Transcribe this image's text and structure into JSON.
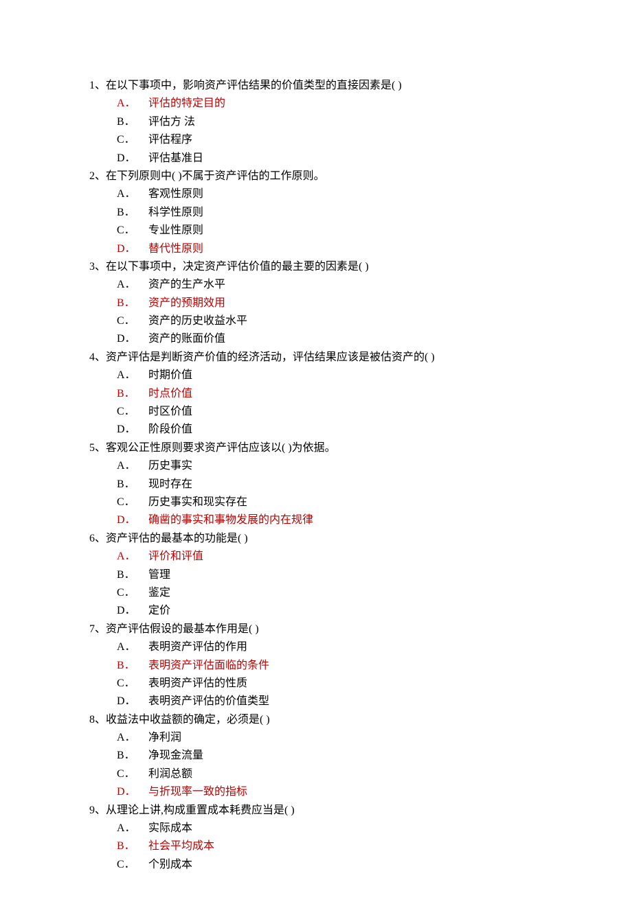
{
  "questions": [
    {
      "num": "1、",
      "text": "在以下事项中，影响资产评估结果的价值类型的直接因素是(    )",
      "options": [
        {
          "letter": "A．",
          "text": "评估的特定目的",
          "correct": true
        },
        {
          "letter": "B．",
          "text": "评估方 法",
          "correct": false
        },
        {
          "letter": "C．",
          "text": "评估程序",
          "correct": false
        },
        {
          "letter": "D．",
          "text": "评估基准日",
          "correct": false
        }
      ]
    },
    {
      "num": "2、",
      "text": "在下列原则中(      )不属于资产评估的工作原则。",
      "options": [
        {
          "letter": "A．",
          "text": "客观性原则",
          "correct": false
        },
        {
          "letter": "B．",
          "text": "科学性原则",
          "correct": false
        },
        {
          "letter": "C．",
          "text": "专业性原则",
          "correct": false
        },
        {
          "letter": "D．",
          "text": "替代性原则",
          "correct": true
        }
      ]
    },
    {
      "num": "3、",
      "text": "在以下事项中，决定资产评估价值的最主要的因素是(    )",
      "options": [
        {
          "letter": "A．",
          "text": "资产的生产水平",
          "correct": false
        },
        {
          "letter": "B．",
          "text": "资产的预期效用",
          "correct": true
        },
        {
          "letter": "C．",
          "text": "资产的历史收益水平",
          "correct": false
        },
        {
          "letter": "D．",
          "text": "资产的账面价值",
          "correct": false
        }
      ]
    },
    {
      "num": "4、",
      "text": "资产评估是判断资产价值的经济活动，评估结果应该是被估资产的(        )",
      "options": [
        {
          "letter": "A．",
          "text": "时期价值",
          "correct": false
        },
        {
          "letter": "B．",
          "text": "时点价值",
          "correct": true
        },
        {
          "letter": "C．",
          "text": "时区价值",
          "correct": false
        },
        {
          "letter": "D．",
          "text": "阶段价值",
          "correct": false
        }
      ]
    },
    {
      "num": "5、",
      "text": "客观公正性原则要求资产评估应该以(          )为依据。",
      "options": [
        {
          "letter": "A．",
          "text": "历史事实",
          "correct": false
        },
        {
          "letter": "B．",
          "text": "现时存在",
          "correct": false
        },
        {
          "letter": "C．",
          "text": "历史事实和现实存在",
          "correct": false
        },
        {
          "letter": "D．",
          "text": "确凿的事实和事物发展的内在规律",
          "correct": true
        }
      ]
    },
    {
      "num": "6、",
      "text": "资产评估的最基本的功能是(        )",
      "options": [
        {
          "letter": "A．",
          "text": "评价和评值",
          "correct": true
        },
        {
          "letter": "B．",
          "text": "管理",
          "correct": false
        },
        {
          "letter": "C．",
          "text": "鉴定",
          "correct": false
        },
        {
          "letter": "D．",
          "text": "定价",
          "correct": false
        }
      ]
    },
    {
      "num": "7、",
      "text": "资产评估假设的最基本作用是(        )",
      "options": [
        {
          "letter": "A．",
          "text": "表明资产评估的作用",
          "correct": false
        },
        {
          "letter": "B．",
          "text": "表明资产评估面临的条件",
          "correct": true
        },
        {
          "letter": "C．",
          "text": "表明资产评估的性质",
          "correct": false
        },
        {
          "letter": "D．",
          "text": "表明资产评估的价值类型",
          "correct": false
        }
      ]
    },
    {
      "num": "8、",
      "text": "收益法中收益额的确定，必须是(        )",
      "options": [
        {
          "letter": "A．",
          "text": "净利润",
          "correct": false
        },
        {
          "letter": "B．",
          "text": "净现金流量",
          "correct": false
        },
        {
          "letter": "C．",
          "text": "利润总额",
          "correct": false
        },
        {
          "letter": "D．",
          "text": "与折现率一致的指标",
          "correct": true
        }
      ]
    },
    {
      "num": "9、",
      "text": "从理论上讲,构成重置成本耗费应当是(        )",
      "options": [
        {
          "letter": "A．",
          "text": "实际成本",
          "correct": false
        },
        {
          "letter": "B．",
          "text": "社会平均成本",
          "correct": true
        },
        {
          "letter": "C．",
          "text": "个别成本",
          "correct": false
        }
      ]
    }
  ]
}
